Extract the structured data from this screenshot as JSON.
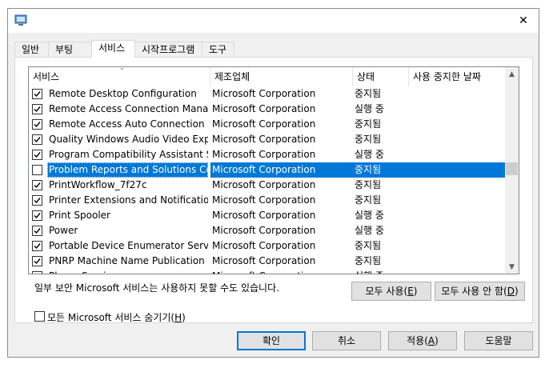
{
  "window": {
    "close_glyph": "✕",
    "icon": "msconfig-icon"
  },
  "tabs": [
    {
      "label": "일반",
      "active": false
    },
    {
      "label": "부팅",
      "active": false
    },
    {
      "label": "서비스",
      "active": true
    },
    {
      "label": "시작프로그램",
      "active": false
    },
    {
      "label": "도구",
      "active": false
    }
  ],
  "columns": {
    "service": "서비스",
    "manufacturer": "제조업체",
    "status": "상태",
    "date_disabled": "사용 중지한 날짜"
  },
  "services": [
    {
      "name": "Remote Desktop Configuration",
      "manufacturer": "Microsoft Corporation",
      "status": "중지됨",
      "date": "",
      "checked": true,
      "selected": false
    },
    {
      "name": "Remote Access Connection Manager",
      "manufacturer": "Microsoft Corporation",
      "status": "실행 중",
      "date": "",
      "checked": true,
      "selected": false
    },
    {
      "name": "Remote Access Auto Connection M...",
      "manufacturer": "Microsoft Corporation",
      "status": "중지됨",
      "date": "",
      "checked": true,
      "selected": false
    },
    {
      "name": "Quality Windows Audio Video Expe...",
      "manufacturer": "Microsoft Corporation",
      "status": "중지됨",
      "date": "",
      "checked": true,
      "selected": false
    },
    {
      "name": "Program Compatibility Assistant Se...",
      "manufacturer": "Microsoft Corporation",
      "status": "실행 중",
      "date": "",
      "checked": true,
      "selected": false
    },
    {
      "name": "Problem Reports and Solutions Con...",
      "manufacturer": "Microsoft Corporation",
      "status": "중지됨",
      "date": "",
      "checked": false,
      "selected": true
    },
    {
      "name": "PrintWorkflow_7f27c",
      "manufacturer": "Microsoft Corporation",
      "status": "중지됨",
      "date": "",
      "checked": true,
      "selected": false
    },
    {
      "name": "Printer Extensions and Notifications",
      "manufacturer": "Microsoft Corporation",
      "status": "중지됨",
      "date": "",
      "checked": true,
      "selected": false
    },
    {
      "name": "Print Spooler",
      "manufacturer": "Microsoft Corporation",
      "status": "실행 중",
      "date": "",
      "checked": true,
      "selected": false
    },
    {
      "name": "Power",
      "manufacturer": "Microsoft Corporation",
      "status": "실행 중",
      "date": "",
      "checked": true,
      "selected": false
    },
    {
      "name": "Portable Device Enumerator Service",
      "manufacturer": "Microsoft Corporation",
      "status": "중지됨",
      "date": "",
      "checked": true,
      "selected": false
    },
    {
      "name": "PNRP Machine Name Publication S...",
      "manufacturer": "Microsoft Corporation",
      "status": "중지됨",
      "date": "",
      "checked": true,
      "selected": false
    },
    {
      "name": "Phone Service",
      "manufacturer": "Microsoft Corporation",
      "status": "실행 중",
      "date": "",
      "checked": true,
      "selected": false
    }
  ],
  "warning_text": "일부 보안 Microsoft 서비스는 사용하지 못할 수도 있습니다.",
  "enable_all": {
    "text": "모두 사용(",
    "key": "E",
    "end": ")"
  },
  "disable_all": {
    "text": "모두 사용 안 함(",
    "key": "D",
    "end": ")"
  },
  "hide_ms": {
    "text": "모든 Microsoft 서비스 숨기기(",
    "key": "H",
    "end": ")",
    "checked": false
  },
  "buttons": {
    "ok": "확인",
    "cancel": "취소",
    "apply": {
      "text": "적용(",
      "key": "A",
      "end": ")"
    },
    "help": "도움말"
  },
  "colors": {
    "selection": "#0078d7",
    "default_button_border": "#0078d7"
  }
}
